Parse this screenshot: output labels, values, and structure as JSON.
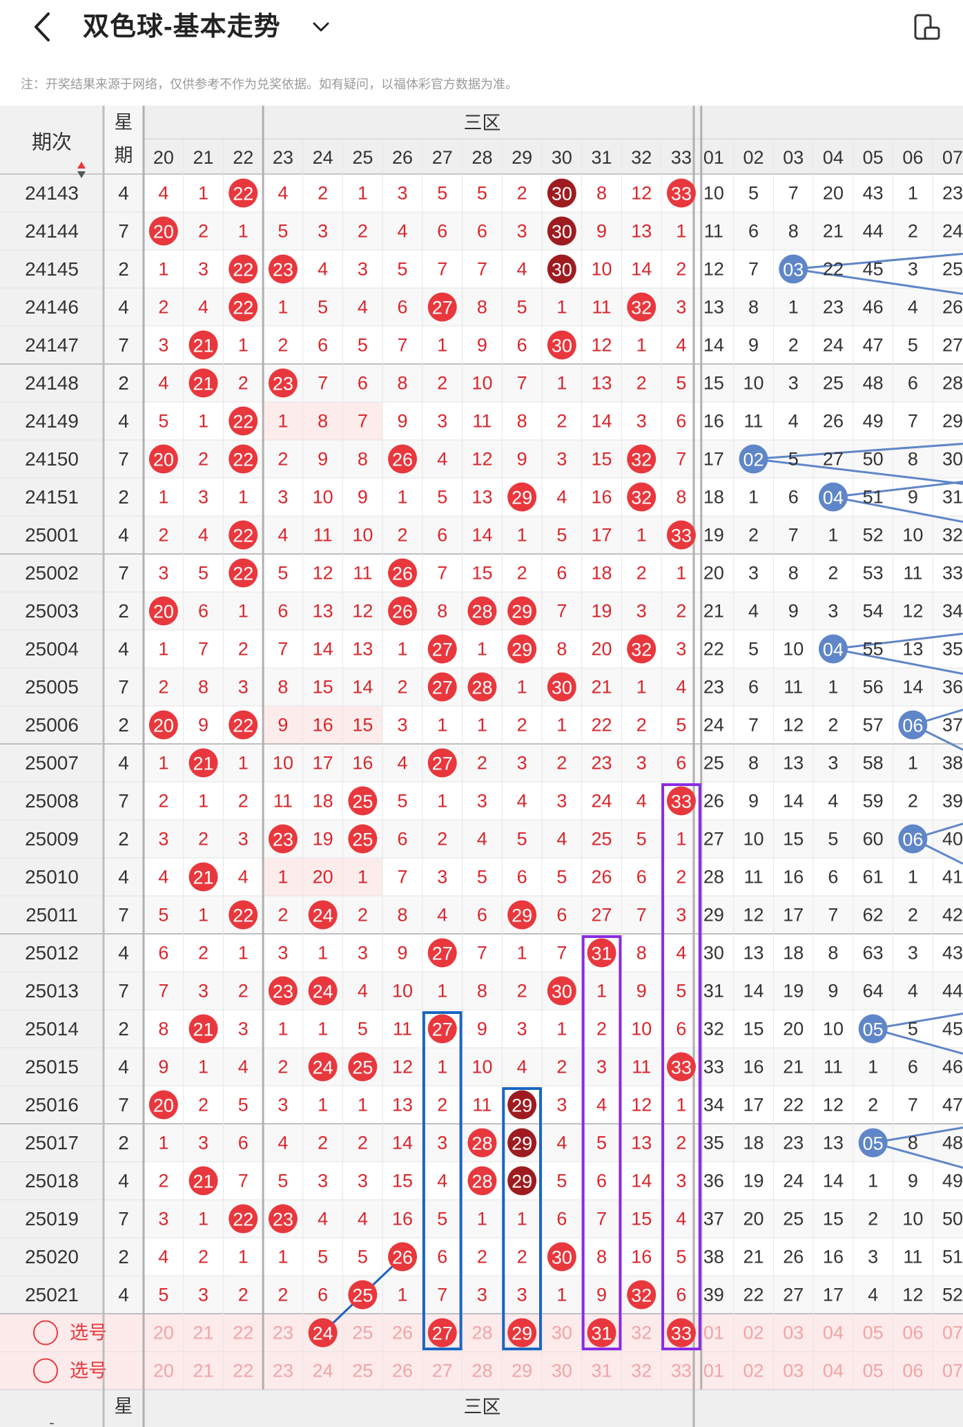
{
  "header": {
    "title": "双色球-基本走势"
  },
  "notice": "注：开奖结果来源于网络，仅供参考不作为兑奖依据。如有疑问，以福体彩官方数据为准。",
  "table": {
    "period_header": "期次",
    "week_header_line1": "星",
    "week_header_line2": "期",
    "zone_label": "三区",
    "red_columns": [
      20,
      21,
      22,
      23,
      24,
      25,
      26,
      27,
      28,
      29,
      30,
      31,
      32,
      33
    ],
    "blue_columns": [
      "01",
      "02",
      "03",
      "04",
      "05",
      "06",
      "07"
    ],
    "pick_label": "选号",
    "colors": {
      "ball_red": "#e8383d",
      "ball_dark": "#9e1c20",
      "ball_blue": "#5f86c8",
      "num_red": "#d9262b",
      "box_blue": "#1a66c2",
      "box_purple": "#8a2be2"
    },
    "rows": [
      {
        "p": "24143",
        "w": "4",
        "r": [
          "4",
          "1",
          "22",
          "4",
          "2",
          "1",
          "3",
          "5",
          "5",
          "2",
          "30",
          "8",
          "12",
          "33"
        ],
        "b": [
          "10",
          "5",
          "7",
          "20",
          "43",
          "1",
          "23"
        ]
      },
      {
        "p": "24144",
        "w": "7",
        "r": [
          "20",
          "2",
          "1",
          "5",
          "3",
          "2",
          "4",
          "6",
          "6",
          "3",
          "30",
          "9",
          "13",
          "1"
        ],
        "b": [
          "11",
          "6",
          "8",
          "21",
          "44",
          "2",
          "24"
        ]
      },
      {
        "p": "24145",
        "w": "2",
        "r": [
          "1",
          "3",
          "22",
          "23",
          "4",
          "3",
          "5",
          "7",
          "7",
          "4",
          "30",
          "10",
          "14",
          "2"
        ],
        "b": [
          "12",
          "7",
          "03",
          "22",
          "45",
          "3",
          "25"
        ]
      },
      {
        "p": "24146",
        "w": "4",
        "r": [
          "2",
          "4",
          "22",
          "1",
          "5",
          "4",
          "6",
          "27",
          "8",
          "5",
          "1",
          "11",
          "32",
          "3"
        ],
        "b": [
          "13",
          "8",
          "1",
          "23",
          "46",
          "4",
          "26"
        ]
      },
      {
        "p": "24147",
        "w": "7",
        "r": [
          "3",
          "21",
          "1",
          "2",
          "6",
          "5",
          "7",
          "1",
          "9",
          "6",
          "30",
          "12",
          "1",
          "4"
        ],
        "b": [
          "14",
          "9",
          "2",
          "24",
          "47",
          "5",
          "27"
        ]
      },
      {
        "p": "24148",
        "w": "2",
        "r": [
          "4",
          "21",
          "2",
          "23",
          "7",
          "6",
          "8",
          "2",
          "10",
          "7",
          "1",
          "13",
          "2",
          "5"
        ],
        "b": [
          "15",
          "10",
          "3",
          "25",
          "48",
          "6",
          "28"
        ]
      },
      {
        "p": "24149",
        "w": "4",
        "r": [
          "5",
          "1",
          "22",
          "1",
          "8",
          "7",
          "9",
          "3",
          "11",
          "8",
          "2",
          "14",
          "3",
          "6"
        ],
        "b": [
          "16",
          "11",
          "4",
          "26",
          "49",
          "7",
          "29"
        ]
      },
      {
        "p": "24150",
        "w": "7",
        "r": [
          "20",
          "2",
          "22",
          "2",
          "9",
          "8",
          "26",
          "4",
          "12",
          "9",
          "3",
          "15",
          "32",
          "7"
        ],
        "b": [
          "17",
          "02",
          "5",
          "27",
          "50",
          "8",
          "30"
        ]
      },
      {
        "p": "24151",
        "w": "2",
        "r": [
          "1",
          "3",
          "1",
          "3",
          "10",
          "9",
          "1",
          "5",
          "13",
          "29",
          "4",
          "16",
          "32",
          "8"
        ],
        "b": [
          "18",
          "1",
          "6",
          "04",
          "51",
          "9",
          "31"
        ]
      },
      {
        "p": "25001",
        "w": "4",
        "r": [
          "2",
          "4",
          "22",
          "4",
          "11",
          "10",
          "2",
          "6",
          "14",
          "1",
          "5",
          "17",
          "1",
          "33"
        ],
        "b": [
          "19",
          "2",
          "7",
          "1",
          "52",
          "10",
          "32"
        ]
      },
      {
        "p": "25002",
        "w": "7",
        "r": [
          "3",
          "5",
          "22",
          "5",
          "12",
          "11",
          "26",
          "7",
          "15",
          "2",
          "6",
          "18",
          "2",
          "1"
        ],
        "b": [
          "20",
          "3",
          "8",
          "2",
          "53",
          "11",
          "33"
        ]
      },
      {
        "p": "25003",
        "w": "2",
        "r": [
          "20",
          "6",
          "1",
          "6",
          "13",
          "12",
          "26",
          "8",
          "28",
          "29",
          "7",
          "19",
          "3",
          "2"
        ],
        "b": [
          "21",
          "4",
          "9",
          "3",
          "54",
          "12",
          "34"
        ]
      },
      {
        "p": "25004",
        "w": "4",
        "r": [
          "1",
          "7",
          "2",
          "7",
          "14",
          "13",
          "1",
          "27",
          "1",
          "29",
          "8",
          "20",
          "32",
          "3"
        ],
        "b": [
          "22",
          "5",
          "10",
          "04",
          "55",
          "13",
          "35"
        ]
      },
      {
        "p": "25005",
        "w": "7",
        "r": [
          "2",
          "8",
          "3",
          "8",
          "15",
          "14",
          "2",
          "27",
          "28",
          "1",
          "30",
          "21",
          "1",
          "4"
        ],
        "b": [
          "23",
          "6",
          "11",
          "1",
          "56",
          "14",
          "36"
        ]
      },
      {
        "p": "25006",
        "w": "2",
        "r": [
          "20",
          "9",
          "22",
          "9",
          "16",
          "15",
          "3",
          "1",
          "1",
          "2",
          "1",
          "22",
          "2",
          "5"
        ],
        "b": [
          "24",
          "7",
          "12",
          "2",
          "57",
          "06",
          "37"
        ]
      },
      {
        "p": "25007",
        "w": "4",
        "r": [
          "1",
          "21",
          "1",
          "10",
          "17",
          "16",
          "4",
          "27",
          "2",
          "3",
          "2",
          "23",
          "3",
          "6"
        ],
        "b": [
          "25",
          "8",
          "13",
          "3",
          "58",
          "1",
          "38"
        ]
      },
      {
        "p": "25008",
        "w": "7",
        "r": [
          "2",
          "1",
          "2",
          "11",
          "18",
          "25",
          "5",
          "1",
          "3",
          "4",
          "3",
          "24",
          "4",
          "33"
        ],
        "b": [
          "26",
          "9",
          "14",
          "4",
          "59",
          "2",
          "39"
        ]
      },
      {
        "p": "25009",
        "w": "2",
        "r": [
          "3",
          "2",
          "3",
          "23",
          "19",
          "25",
          "6",
          "2",
          "4",
          "5",
          "4",
          "25",
          "5",
          "1"
        ],
        "b": [
          "27",
          "10",
          "15",
          "5",
          "60",
          "06",
          "40"
        ]
      },
      {
        "p": "25010",
        "w": "4",
        "r": [
          "4",
          "21",
          "4",
          "1",
          "20",
          "1",
          "7",
          "3",
          "5",
          "6",
          "5",
          "26",
          "6",
          "2"
        ],
        "b": [
          "28",
          "11",
          "16",
          "6",
          "61",
          "1",
          "41"
        ]
      },
      {
        "p": "25011",
        "w": "7",
        "r": [
          "5",
          "1",
          "22",
          "2",
          "24",
          "2",
          "8",
          "4",
          "6",
          "29",
          "6",
          "27",
          "7",
          "3"
        ],
        "b": [
          "29",
          "12",
          "17",
          "7",
          "62",
          "2",
          "42"
        ]
      },
      {
        "p": "25012",
        "w": "4",
        "r": [
          "6",
          "2",
          "1",
          "3",
          "1",
          "3",
          "9",
          "27",
          "7",
          "1",
          "7",
          "31",
          "8",
          "4"
        ],
        "b": [
          "30",
          "13",
          "18",
          "8",
          "63",
          "3",
          "43"
        ]
      },
      {
        "p": "25013",
        "w": "7",
        "r": [
          "7",
          "3",
          "2",
          "23",
          "24",
          "4",
          "10",
          "1",
          "8",
          "2",
          "30",
          "1",
          "9",
          "5"
        ],
        "b": [
          "31",
          "14",
          "19",
          "9",
          "64",
          "4",
          "44"
        ]
      },
      {
        "p": "25014",
        "w": "2",
        "r": [
          "8",
          "21",
          "3",
          "1",
          "1",
          "5",
          "11",
          "27",
          "9",
          "3",
          "1",
          "2",
          "10",
          "6"
        ],
        "b": [
          "32",
          "15",
          "20",
          "10",
          "05",
          "5",
          "45"
        ]
      },
      {
        "p": "25015",
        "w": "4",
        "r": [
          "9",
          "1",
          "4",
          "2",
          "24",
          "25",
          "12",
          "1",
          "10",
          "4",
          "2",
          "3",
          "11",
          "33"
        ],
        "b": [
          "33",
          "16",
          "21",
          "11",
          "1",
          "6",
          "46"
        ]
      },
      {
        "p": "25016",
        "w": "7",
        "r": [
          "20",
          "2",
          "5",
          "3",
          "1",
          "1",
          "13",
          "2",
          "11",
          "29",
          "3",
          "4",
          "12",
          "1"
        ],
        "b": [
          "34",
          "17",
          "22",
          "12",
          "2",
          "7",
          "47"
        ]
      },
      {
        "p": "25017",
        "w": "2",
        "r": [
          "1",
          "3",
          "6",
          "4",
          "2",
          "2",
          "14",
          "3",
          "28",
          "29",
          "4",
          "5",
          "13",
          "2"
        ],
        "b": [
          "35",
          "18",
          "23",
          "13",
          "05",
          "8",
          "48"
        ]
      },
      {
        "p": "25018",
        "w": "4",
        "r": [
          "2",
          "21",
          "7",
          "5",
          "3",
          "3",
          "15",
          "4",
          "28",
          "29",
          "5",
          "6",
          "14",
          "3"
        ],
        "b": [
          "36",
          "19",
          "24",
          "14",
          "1",
          "9",
          "49"
        ]
      },
      {
        "p": "25019",
        "w": "7",
        "r": [
          "3",
          "1",
          "22",
          "23",
          "4",
          "4",
          "16",
          "5",
          "1",
          "1",
          "6",
          "7",
          "15",
          "4"
        ],
        "b": [
          "37",
          "20",
          "25",
          "15",
          "2",
          "10",
          "50"
        ]
      },
      {
        "p": "25020",
        "w": "2",
        "r": [
          "4",
          "2",
          "1",
          "1",
          "5",
          "5",
          "26",
          "6",
          "2",
          "2",
          "30",
          "8",
          "16",
          "5"
        ],
        "b": [
          "38",
          "21",
          "26",
          "16",
          "3",
          "11",
          "51"
        ]
      },
      {
        "p": "25021",
        "w": "4",
        "r": [
          "5",
          "3",
          "2",
          "2",
          "6",
          "25",
          "1",
          "7",
          "3",
          "3",
          "1",
          "9",
          "32",
          "6"
        ],
        "b": [
          "39",
          "22",
          "27",
          "17",
          "4",
          "12",
          "52"
        ]
      }
    ],
    "pick_rows": [
      {
        "label": "选号",
        "r": [
          "20",
          "21",
          "22",
          "23",
          "24",
          "25",
          "26",
          "27",
          "28",
          "29",
          "30",
          "31",
          "32",
          "33"
        ],
        "b": [
          "01",
          "02",
          "03",
          "04",
          "05",
          "06",
          "07"
        ],
        "sel": [
          "24",
          "27",
          "29",
          "31",
          "33"
        ]
      },
      {
        "label": "选号",
        "r": [
          "20",
          "21",
          "22",
          "23",
          "24",
          "25",
          "26",
          "27",
          "28",
          "29",
          "30",
          "31",
          "32",
          "33"
        ],
        "b": [
          "01",
          "02",
          "03",
          "04",
          "05",
          "06",
          "07"
        ],
        "sel": []
      }
    ]
  }
}
